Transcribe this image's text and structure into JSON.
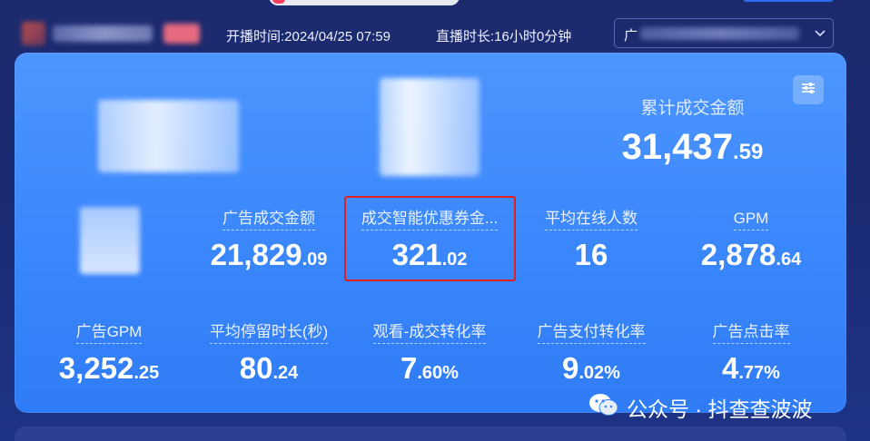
{
  "header": {
    "live_start_label": "开播时间:",
    "live_start_value": "2024/04/25 07:59",
    "duration_label": "直播时长:",
    "duration_value": "16小时0分钟",
    "select_prefix": "广"
  },
  "summary": {
    "total_gmv_label": "累计成交金额",
    "total_gmv_int": "31,437",
    "total_gmv_dec": ".59"
  },
  "metrics_row1": [
    {
      "label": "广告成交金额",
      "int": "21,829",
      "dec": ".09"
    },
    {
      "label": "成交智能优惠券金...",
      "int": "321",
      "dec": ".02"
    },
    {
      "label": "平均在线人数",
      "int": "16",
      "dec": ""
    },
    {
      "label": "GPM",
      "int": "2,878",
      "dec": ".64"
    }
  ],
  "metrics_row2": [
    {
      "label": "广告GPM",
      "int": "3,252",
      "dec": ".25"
    },
    {
      "label": "平均停留时长(秒)",
      "int": "80",
      "dec": ".24"
    },
    {
      "label": "观看-成交转化率",
      "int": "7",
      "dec": ".60%"
    },
    {
      "label": "广告支付转化率",
      "int": "9",
      "dec": ".02%"
    },
    {
      "label": "广告点击率",
      "int": "4",
      "dec": ".77%"
    }
  ],
  "watermark": {
    "text": "公众号 · 抖查查波波",
    "icon": "wechat-icon"
  },
  "icons": {
    "settings": "sliders-icon",
    "select_chevron": "chevron-down-icon"
  },
  "colors": {
    "panel_top": "#4d96ff",
    "panel_bottom": "#2f7cf6",
    "highlight": "#e02020",
    "background": "#1c2a6e"
  }
}
